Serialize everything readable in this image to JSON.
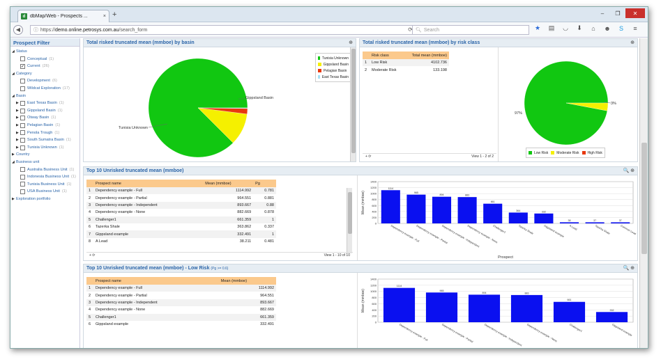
{
  "browser": {
    "tab_title": "dbMap/Web - Prospects ...",
    "tab_close": "×",
    "new_tab": "+",
    "url_prefix": "https://",
    "url_domain": "demo.online.petrosys.com.au",
    "url_path": "/search_form",
    "search_placeholder": "Search",
    "window_controls": [
      "–",
      "❐",
      "✕"
    ],
    "toolbar_icons": [
      "star-icon",
      "clipboard-icon",
      "pocket-icon",
      "download-icon",
      "home-icon",
      "smile-icon",
      "skype-icon",
      "menu-icon"
    ]
  },
  "sidebar": {
    "title": "Prospect Filter",
    "items": [
      {
        "level": 0,
        "arrow": "◢",
        "label": "Status",
        "checkbox": false
      },
      {
        "level": 1,
        "label": "Conceptual",
        "count": "(1)",
        "checkbox": true,
        "checked": false
      },
      {
        "level": 1,
        "label": "Current",
        "count": "(26)",
        "checkbox": true,
        "checked": true
      },
      {
        "level": 0,
        "arrow": "◢",
        "label": "Category",
        "checkbox": false
      },
      {
        "level": 1,
        "label": "Development",
        "count": "(6)",
        "checkbox": true,
        "checked": false
      },
      {
        "level": 1,
        "label": "Wildcat Exploration",
        "count": "(17)",
        "checkbox": true,
        "checked": false
      },
      {
        "level": 0,
        "arrow": "◢",
        "label": "Basin",
        "checkbox": false
      },
      {
        "level": 1,
        "arrow": "▶",
        "label": "East Texas Basin",
        "count": "(1)",
        "checkbox": true,
        "checked": false
      },
      {
        "level": 1,
        "arrow": "▶",
        "label": "Gippsland Basin",
        "count": "(1)",
        "checkbox": true,
        "checked": false
      },
      {
        "level": 1,
        "arrow": "▶",
        "label": "Otway Basin",
        "count": "(1)",
        "checkbox": true,
        "checked": false
      },
      {
        "level": 1,
        "arrow": "▶",
        "label": "Pelagian Basin",
        "count": "(1)",
        "checkbox": true,
        "checked": false
      },
      {
        "level": 1,
        "arrow": "▶",
        "label": "Penola Trough",
        "count": "(1)",
        "checkbox": true,
        "checked": false
      },
      {
        "level": 1,
        "arrow": "▶",
        "label": "South Sumatra Basin",
        "count": "(1)",
        "checkbox": true,
        "checked": false
      },
      {
        "level": 1,
        "arrow": "▶",
        "label": "Tunisia Unknown",
        "count": "(1)",
        "checkbox": true,
        "checked": false
      },
      {
        "level": 0,
        "arrow": "▶",
        "label": "Country",
        "checkbox": false
      },
      {
        "level": 0,
        "arrow": "◢",
        "label": "Business unit",
        "checkbox": false
      },
      {
        "level": 1,
        "label": "Australia Business Unit",
        "count": "(1)",
        "checkbox": true,
        "checked": false
      },
      {
        "level": 1,
        "label": "Indonesia Business Unit",
        "count": "(1)",
        "checkbox": true,
        "checked": false
      },
      {
        "level": 1,
        "label": "Tunisia Business Unit",
        "count": "(1)",
        "checkbox": true,
        "checked": false
      },
      {
        "level": 1,
        "label": "USA Business Unit",
        "count": "(1)",
        "checkbox": true,
        "checked": false
      },
      {
        "level": 0,
        "arrow": "▶",
        "label": "Exploration portfolio",
        "checkbox": false
      }
    ]
  },
  "panels": {
    "basin": {
      "title": "Total risked truncated mean (mmboe) by basin",
      "icons": "⊕"
    },
    "risk": {
      "title": "Total risked truncated mean (mmboe) by risk class",
      "icons": "⊕",
      "columns": [
        "Risk class",
        "Total mean (mmboe)"
      ],
      "rows": [
        {
          "n": "1",
          "name": "Low Risk",
          "value": "4102.736"
        },
        {
          "n": "2",
          "name": "Moderate Risk",
          "value": "133.198"
        }
      ],
      "pager": "View 1 - 2 of 2",
      "pager_icons": "+  ⟳"
    },
    "top10": {
      "title": "Top 10 Unrisked truncated mean (mmboe)",
      "icons": "🔍 ⊕",
      "columns": [
        "Prospect name",
        "Mean (mmboe)",
        "Pg"
      ],
      "rows": [
        {
          "n": "1",
          "name": "Dependency example - Full",
          "mean": "1114.992",
          "pg": "0.781"
        },
        {
          "n": "2",
          "name": "Dependency example - Partial",
          "mean": "964.551",
          "pg": "0.881"
        },
        {
          "n": "3",
          "name": "Dependency example - Independent",
          "mean": "893.667",
          "pg": "0.88"
        },
        {
          "n": "4",
          "name": "Dependency example - None",
          "mean": "882.669",
          "pg": "0.878"
        },
        {
          "n": "5",
          "name": "Challenger1",
          "mean": "661.359",
          "pg": "1"
        },
        {
          "n": "6",
          "name": "Tazerka Shale",
          "mean": "363.862",
          "pg": "0.337"
        },
        {
          "n": "7",
          "name": "Gippsland example",
          "mean": "332.491",
          "pg": "1"
        },
        {
          "n": "8",
          "name": "A Lead",
          "mean": "38.211",
          "pg": "0.481"
        }
      ],
      "pager": "View 1 - 10 of 10",
      "pager_icons": "+  ⟳"
    },
    "top10low": {
      "title": "Top 10 Unrisked truncated mean (mmboe) - Low Risk",
      "subtitle": "(Pg >= 0.6)",
      "icons": "🔍 ⊕",
      "columns": [
        "Prospect name",
        "Mean (mmboe)"
      ],
      "rows": [
        {
          "n": "1",
          "name": "Dependency example - Full",
          "mean": "1114.992"
        },
        {
          "n": "2",
          "name": "Dependency example - Partial",
          "mean": "964.551"
        },
        {
          "n": "3",
          "name": "Dependency example - Independent",
          "mean": "893.667"
        },
        {
          "n": "4",
          "name": "Dependency example - None",
          "mean": "882.669"
        },
        {
          "n": "5",
          "name": "Challenger1",
          "mean": "661.359"
        },
        {
          "n": "6",
          "name": "Gippsland example",
          "mean": "332.491"
        }
      ]
    }
  },
  "chart_data": [
    {
      "type": "pie",
      "labels": [
        "Tunisia Unknown",
        "Gippsland Basin",
        "Pelagian Basin",
        "East Texas Basin"
      ],
      "values": [
        87.5,
        10.5,
        1.8,
        0.2
      ],
      "colors": [
        "#11c711",
        "#f5f000",
        "#e8380e",
        "#a6e0f5"
      ],
      "slice_labels": [
        "Tunisia Unknown",
        "Gippsland Basin"
      ],
      "legend": "top-right"
    },
    {
      "type": "pie",
      "labels": [
        "Low Risk",
        "Moderate Risk",
        "High Risk"
      ],
      "values": [
        97,
        3,
        0
      ],
      "colors": [
        "#11c711",
        "#f5f000",
        "#e8380e"
      ],
      "slice_labels": [
        "97%",
        "3%"
      ],
      "legend": "bottom"
    },
    {
      "type": "bar",
      "categories": [
        "Dependency example - Full",
        "Dependency example - Partial",
        "Dependency example - Independent",
        "Dependency example - None",
        "Challenger1",
        "Tazerka Shale",
        "Gippsland example",
        "A Lead",
        "Tazerka Shale",
        "Common Lead"
      ],
      "values": [
        1114,
        965,
        894,
        883,
        661,
        364,
        332,
        38,
        37,
        37
      ],
      "value_labels": [
        "1114",
        "965",
        "894",
        "883",
        "661",
        "364",
        "332",
        "38",
        "37",
        "37"
      ],
      "color": "#0a10f0",
      "xlabel": "Prospect",
      "ylabel": "Mean (mmboe)",
      "ylim": [
        0,
        1400
      ],
      "yticks": [
        0,
        200,
        400,
        600,
        800,
        1000,
        1200,
        1400
      ],
      "grid": true
    },
    {
      "type": "bar",
      "categories": [
        "Dependency example - Full",
        "Dependency example - Partial",
        "Dependency example - Independent",
        "Dependency example - None",
        "Challenger1",
        "Gippsland example"
      ],
      "values": [
        1114,
        965,
        894,
        883,
        661,
        332
      ],
      "value_labels": [
        "1114",
        "965",
        "894",
        "883",
        "661",
        "332"
      ],
      "color": "#0a10f0",
      "xlabel": "",
      "ylabel": "Mean (mmboe)",
      "ylim": [
        0,
        1400
      ],
      "yticks": [
        0,
        200,
        400,
        600,
        800,
        1000,
        1200,
        1400
      ],
      "grid": true
    }
  ]
}
